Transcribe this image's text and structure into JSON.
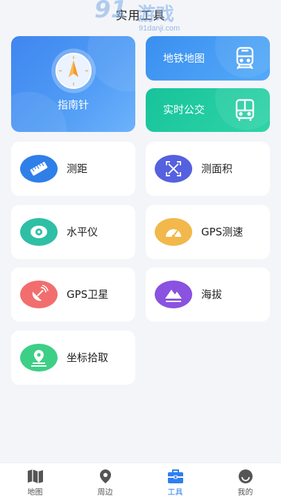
{
  "header": {
    "title": "实用工具"
  },
  "watermark": {
    "logo": "91",
    "text": "游戏",
    "url": "91danji.com"
  },
  "featured": {
    "compass": {
      "label": "指南针",
      "color": "#4a90f0"
    },
    "metro": {
      "label": "地铁地图",
      "color": "#4a9df5",
      "icon": "train-icon"
    },
    "bus": {
      "label": "实时公交",
      "color": "#1ec8a0",
      "icon": "bus-icon"
    }
  },
  "tools": [
    {
      "label": "测距",
      "icon": "ruler-icon",
      "color": "#2f7fe8"
    },
    {
      "label": "测面积",
      "icon": "area-measure-icon",
      "color": "#5561df"
    },
    {
      "label": "水平仪",
      "icon": "level-icon",
      "color": "#2fbfa6"
    },
    {
      "label": "GPS测速",
      "icon": "speedometer-icon",
      "color": "#f2b84b"
    },
    {
      "label": "GPS卫星",
      "icon": "satellite-icon",
      "color": "#f26e6e"
    },
    {
      "label": "海拔",
      "icon": "mountain-icon",
      "color": "#8a52e0"
    },
    {
      "label": "坐标拾取",
      "icon": "location-pin-icon",
      "color": "#3ecf86"
    }
  ],
  "tabbar": {
    "active": "工具",
    "active_color": "#2f7df0",
    "items": [
      {
        "label": "地图",
        "icon": "map-icon"
      },
      {
        "label": "周边",
        "icon": "nearby-pin-icon"
      },
      {
        "label": "工具",
        "icon": "toolbox-icon"
      },
      {
        "label": "我的",
        "icon": "profile-icon"
      }
    ]
  }
}
